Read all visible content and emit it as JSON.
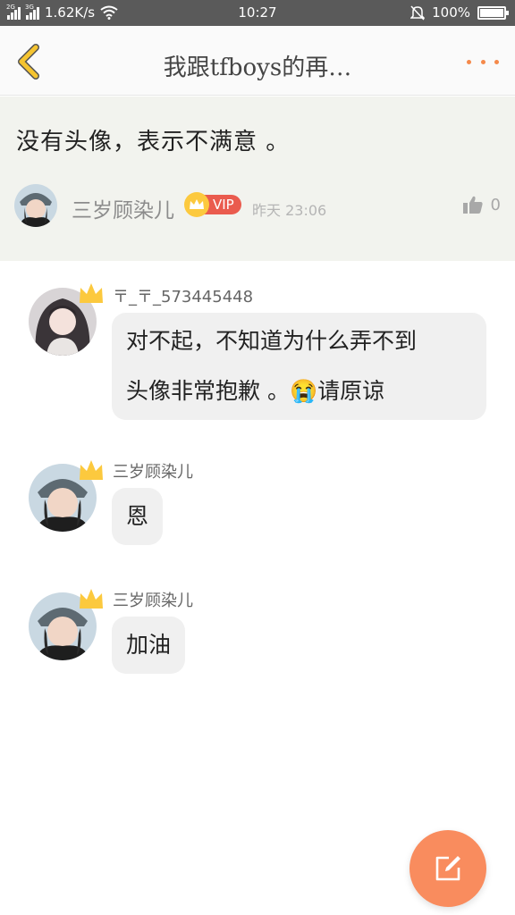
{
  "status_bar": {
    "net_tag_1": "2G",
    "net_tag_2": "3G",
    "speed": "1.62K/s",
    "time": "10:27",
    "battery": "100%"
  },
  "header": {
    "title": "我跟tfboys的再…"
  },
  "post": {
    "text": "没有头像，表示不满意 。",
    "author": "三岁顾染儿",
    "vip_label": "VIP",
    "time": "昨天 23:06",
    "like_count": "0"
  },
  "comments": [
    {
      "name": "〒_〒_573445448",
      "lines": [
        "对不起，不知道为什么弄不到",
        "头像非常抱歉 。😭请原谅"
      ]
    },
    {
      "name": "三岁顾染儿",
      "lines": [
        "恩"
      ]
    },
    {
      "name": "三岁顾染儿",
      "lines": [
        "加油"
      ]
    }
  ],
  "icons": {
    "back": "chevron-left-icon",
    "more": "more-dots-icon",
    "like": "thumbs-up-icon",
    "compose": "edit-icon",
    "wifi": "wifi-icon",
    "mute": "bell-off-icon"
  },
  "colors": {
    "accent": "#f5894a",
    "back_arrow": "#f5c430",
    "vip": "#ea5b4e",
    "crown": "#fcc93e",
    "post_bg": "#f2f3ee",
    "bubble_bg": "#f0f0f0",
    "fab": "#f98c5e"
  }
}
